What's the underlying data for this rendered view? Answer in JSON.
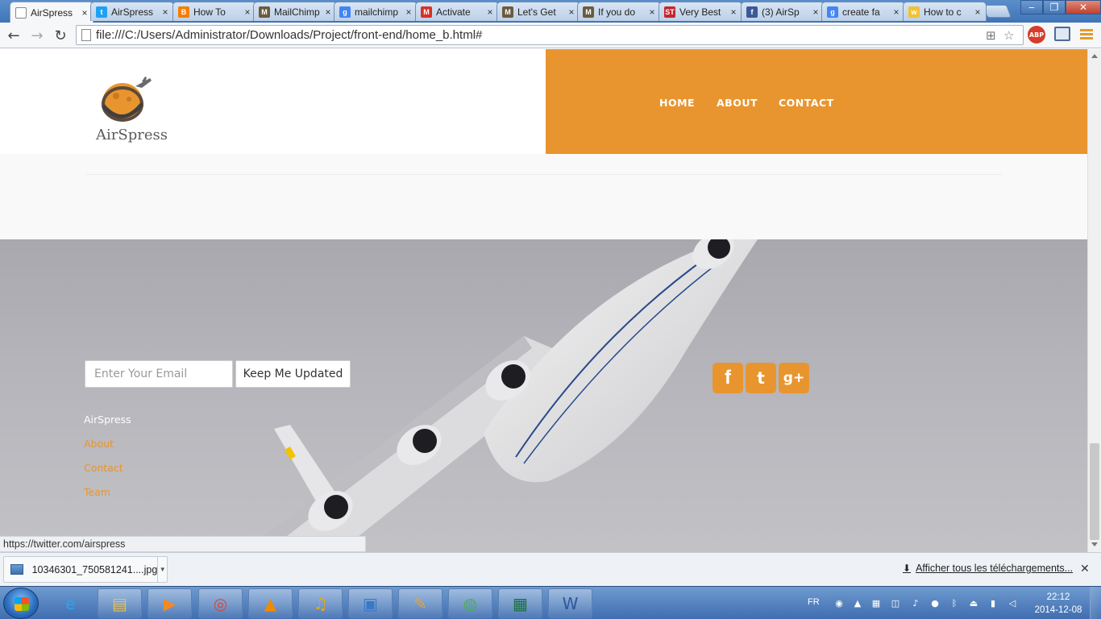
{
  "browser": {
    "tabs": [
      {
        "label": "AirSpress",
        "icon": "page-icon",
        "color": "#ffffff",
        "active": true
      },
      {
        "label": "AirSpress",
        "icon": "twitter-icon",
        "color": "#1da1f2"
      },
      {
        "label": "How To",
        "icon": "blogger-icon",
        "color": "#f57d00"
      },
      {
        "label": "MailChimp",
        "icon": "mailchimp-icon",
        "color": "#6b5b3e"
      },
      {
        "label": "mailchimp",
        "icon": "google-icon",
        "color": "#4285f4"
      },
      {
        "label": "Activate",
        "icon": "gmail-icon",
        "color": "#d93025"
      },
      {
        "label": "Let's Get",
        "icon": "mailchimp-icon",
        "color": "#6b5b3e"
      },
      {
        "label": "If you do",
        "icon": "mailchimp-icon",
        "color": "#6b5b3e"
      },
      {
        "label": "Very Best",
        "icon": "st-icon",
        "color": "#c4262e"
      },
      {
        "label": "(3) AirSp",
        "icon": "facebook-icon",
        "color": "#3b5998"
      },
      {
        "label": "create fa",
        "icon": "google-icon",
        "color": "#4285f4"
      },
      {
        "label": "How to c",
        "icon": "wikihow-icon",
        "color": "#f1c232"
      }
    ],
    "tab_close": "×",
    "url": "file:///C:/Users/Administrator/Downloads/Project/front-end/home_b.html#",
    "abp_label": "ABP",
    "status_url": "https://twitter.com/airspress"
  },
  "site": {
    "logo_text": "AirSpress",
    "nav": [
      "HOME",
      "ABOUT",
      "CONTACT"
    ],
    "accent": "#e8952f",
    "newsletter": {
      "placeholder": "Enter Your Email",
      "button": "Keep Me Updated"
    },
    "footer": {
      "brand": "AirSpress",
      "links": [
        "About",
        "Contact",
        "Team"
      ]
    },
    "social": [
      "facebook-icon",
      "twitter-icon",
      "google-plus-icon"
    ],
    "social_glyphs": [
      "f",
      "t",
      "g+"
    ]
  },
  "downloads": {
    "item": "10346301_750581241....jpg",
    "show_all": "Afficher tous les téléchargements..."
  },
  "taskbar": {
    "lang": "FR",
    "time": "22:12",
    "date": "2014-12-08",
    "apps": [
      "internet-explorer-icon",
      "file-explorer-icon",
      "media-player-icon",
      "chrome-icon",
      "vlc-icon",
      "audacity-icon",
      "control-panel-icon",
      "paint-icon",
      "network-icon",
      "excel-icon",
      "word-icon"
    ]
  }
}
